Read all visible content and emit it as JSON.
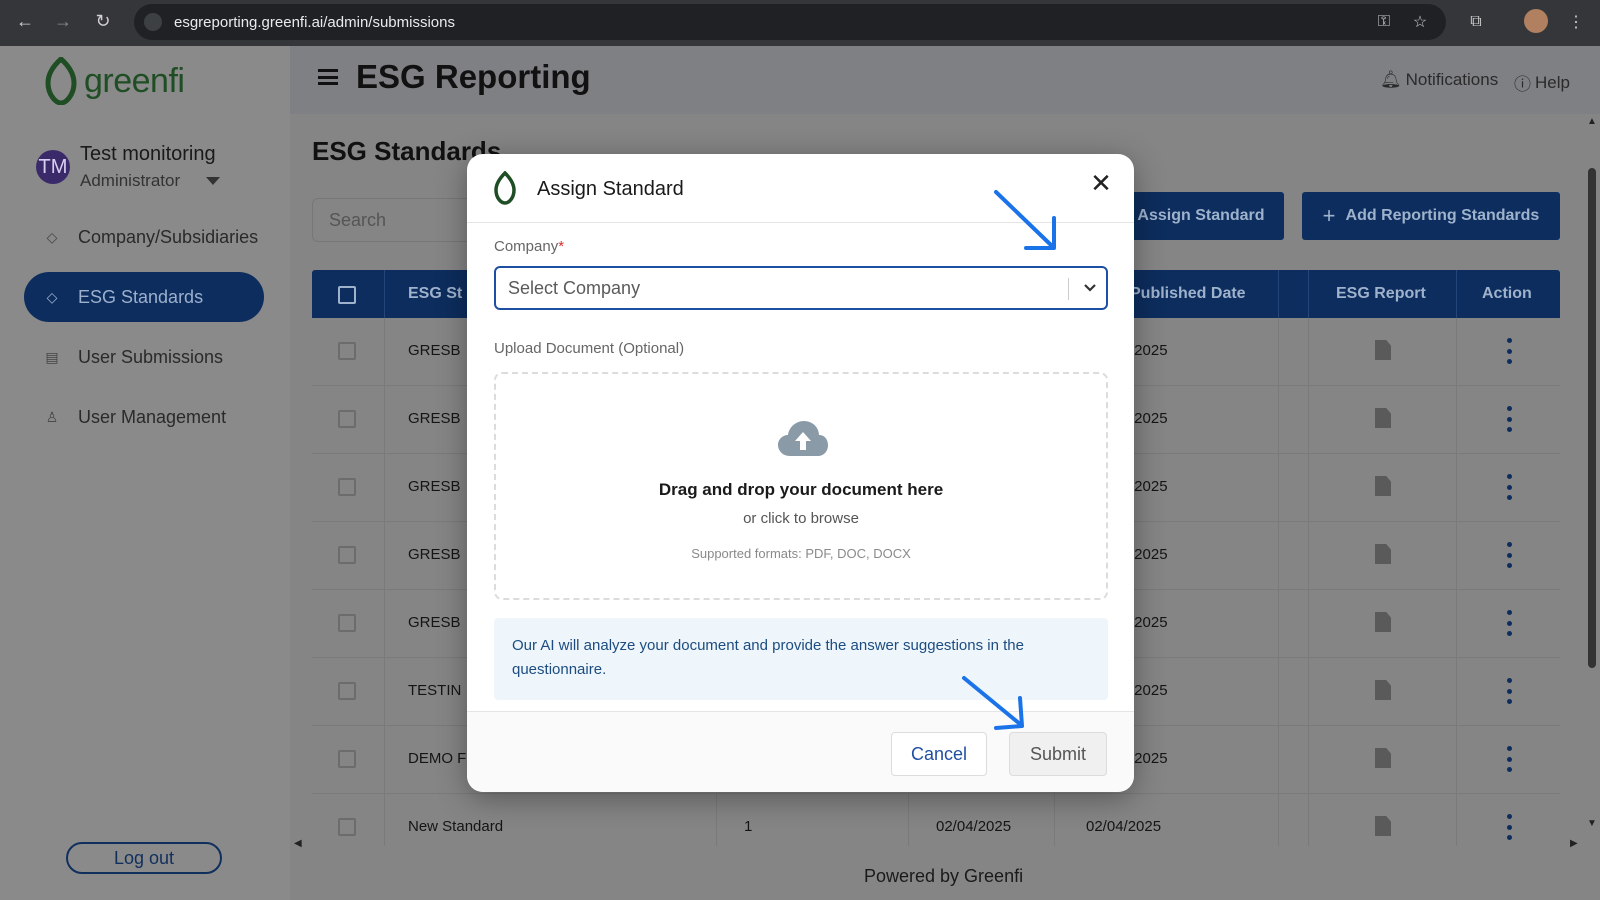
{
  "browser": {
    "url": "esgreporting.greenfi.ai/admin/submissions"
  },
  "sidebar": {
    "logo_text": "greenfi",
    "user_initials": "TM",
    "user_name": "Test monitoring",
    "user_role": "Administrator",
    "items": [
      {
        "label": "Company/Subsidiaries",
        "icon": "diamond-icon"
      },
      {
        "label": "ESG Standards",
        "icon": "diamond-icon",
        "active": true
      },
      {
        "label": "User Submissions",
        "icon": "clipboard-icon"
      },
      {
        "label": "User Management",
        "icon": "person-icon"
      }
    ],
    "logout_label": "Log out"
  },
  "header": {
    "title": "ESG Reporting",
    "notifications_label": "Notifications",
    "help_label": "Help"
  },
  "main": {
    "section_title": "ESG Standards",
    "search_placeholder": "Search",
    "assign_button": "Assign Standard",
    "add_button": "Add Reporting Standards",
    "columns": [
      "ESG St",
      "Published Date",
      "ESG Report",
      "Action"
    ],
    "rows": [
      {
        "name": "GRESB",
        "date": "/2025"
      },
      {
        "name": "GRESB",
        "date": "/2025"
      },
      {
        "name": "GRESB",
        "date": "/2025"
      },
      {
        "name": "GRESB",
        "date": "/2025"
      },
      {
        "name": "GRESB",
        "date": "/2025"
      },
      {
        "name": "TESTIN",
        "date": "/2025"
      },
      {
        "name": "DEMO F",
        "date": "/2025"
      },
      {
        "name": "New Standard",
        "count": "1",
        "created": "02/04/2025",
        "date": "02/04/2025"
      }
    ]
  },
  "footer": {
    "text": "Powered by Greenfi"
  },
  "modal": {
    "title": "Assign Standard",
    "company_label": "Company",
    "required_mark": "*",
    "company_placeholder": "Select Company",
    "upload_label": "Upload Document (Optional)",
    "dropzone_main": "Drag and drop your document here",
    "dropzone_sub": "or click to browse",
    "dropzone_formats": "Supported formats: PDF, DOC, DOCX",
    "info_text": "Our AI will analyze your document and provide the answer suggestions in the questionnaire.",
    "cancel_label": "Cancel",
    "submit_label": "Submit"
  },
  "colors": {
    "brand_navy": "#0d2d5e",
    "brand_green": "#1f4d24",
    "annotation_blue": "#1a73e8"
  }
}
